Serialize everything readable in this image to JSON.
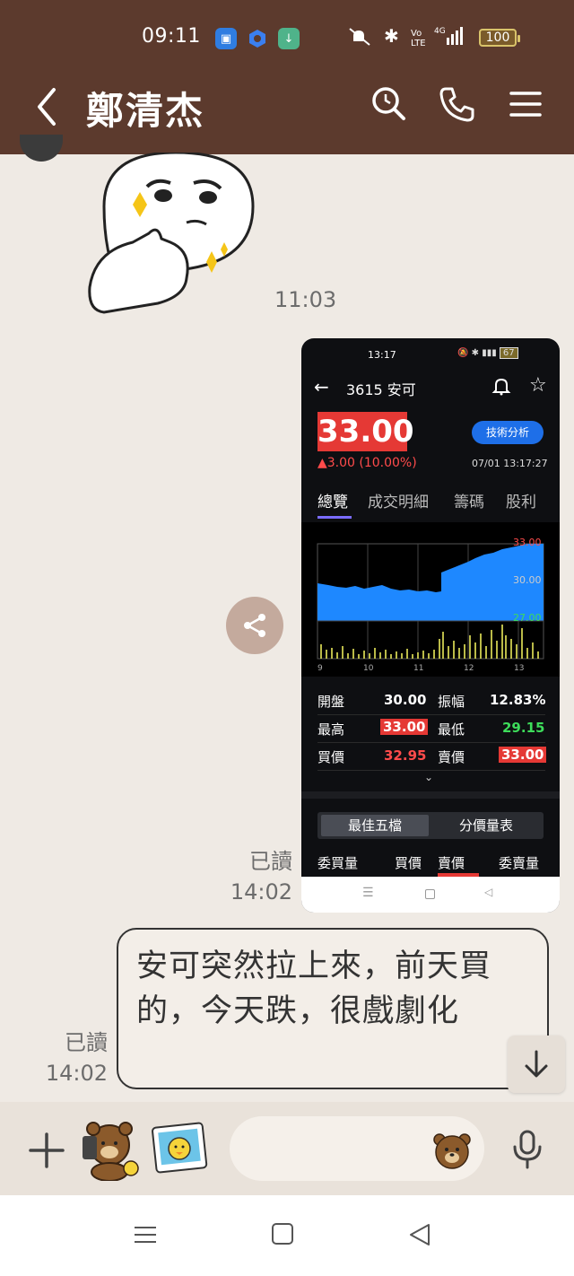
{
  "status_bar": {
    "time": "09:11",
    "network": "4G",
    "battery": "100"
  },
  "header": {
    "contact_name": "鄭清杰",
    "icons": [
      "back-icon",
      "search-icon",
      "phone-icon",
      "menu-icon"
    ]
  },
  "messages": {
    "sticker_time": "11:03",
    "image_read": "已讀",
    "image_time": "14:02",
    "text_read": "已讀",
    "text_time": "14:02",
    "text_message": "安可突然拉上來，前天買的，今天跌，很戲劇化"
  },
  "screenshot": {
    "status_time": "13:17",
    "status_battery": "67",
    "stock_title": "3615 安可",
    "price": "33.00",
    "change": "▲3.00 (10.00%)",
    "tech_button": "技術分析",
    "datetime": "07/01 13:17:27",
    "tabs": [
      "總覽",
      "成交明細",
      "籌碼",
      "股利"
    ],
    "chart_labels": {
      "y_high": "33.00",
      "y_mid": "30.00",
      "y_low": "27.00",
      "x_ticks": [
        "9",
        "10",
        "11",
        "12",
        "13"
      ]
    },
    "summary": {
      "open_label": "開盤",
      "open_value": "30.00",
      "amp_label": "振幅",
      "amp_value": "12.83%",
      "high_label": "最高",
      "high_value": "33.00",
      "low_label": "最低",
      "low_value": "29.15",
      "bid_label": "買價",
      "bid_value": "32.95",
      "ask_label": "賣價",
      "ask_value": "33.00"
    },
    "segment": {
      "best5": "最佳五檔",
      "price_volume": "分價量表"
    },
    "columns": [
      "委買量",
      "買價",
      "賣價",
      "委賣量"
    ]
  },
  "colors": {
    "header_bg": "#5c3a2d",
    "chat_bg": "#efeae4",
    "price_red": "#e53935",
    "chart_blue": "#1e88ff",
    "volume_yellow": "#e8e85a"
  }
}
